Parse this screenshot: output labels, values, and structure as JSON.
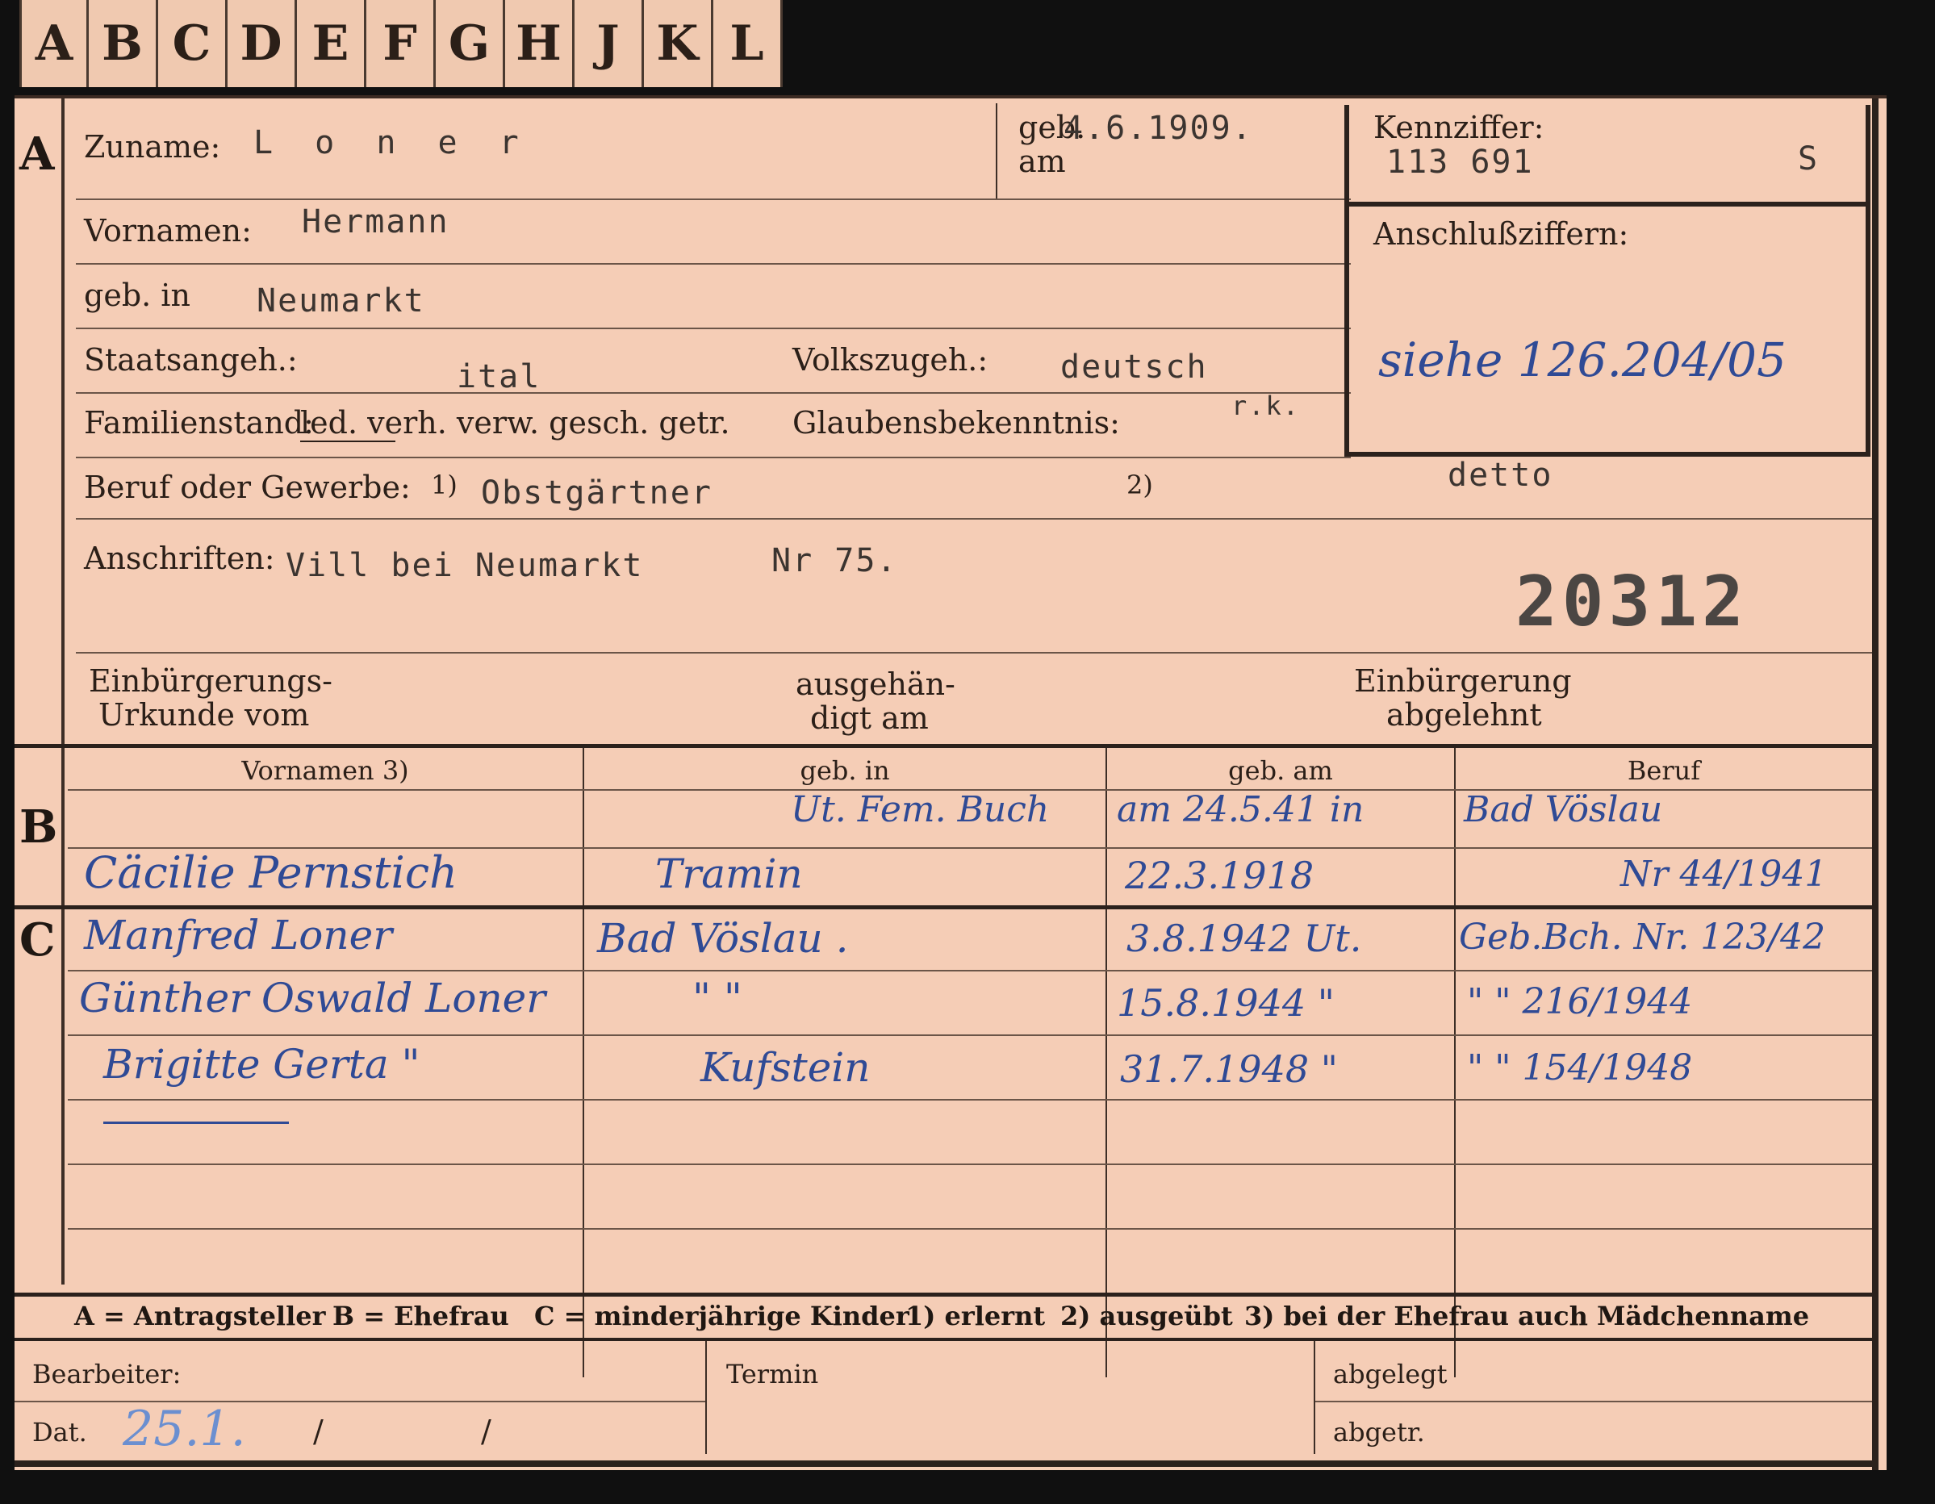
{
  "tabs": [
    "A",
    "B",
    "C",
    "D",
    "E",
    "F",
    "G",
    "H",
    "J",
    "K",
    "L"
  ],
  "section_letters": {
    "a": "A",
    "b": "B",
    "c": "C"
  },
  "applicant": {
    "surname_label": "Zuname:",
    "surname": "L o n e r",
    "birthdate_label_top": "geb.",
    "birthdate_label_bottom": "am",
    "birthdate": "4.6.1909.",
    "given_names_label": "Vornamen:",
    "given_names": "Hermann",
    "birthplace_label": "geb. in",
    "birthplace": "Neumarkt",
    "citizenship_label": "Staatsangeh.:",
    "citizenship": "ital",
    "ethnicity_label": "Volkszugeh.:",
    "ethnicity": "deutsch",
    "marital_label": "Familienstand:",
    "marital_options": "led. verh. verw. gesch. getr.",
    "religion_label": "Glaubensbekenntnis:",
    "religion": "r.k.",
    "occupation_label": "Beruf oder Gewerbe:",
    "occupation_note1": "1)",
    "occupation": "Obstgärtner",
    "occupation_note2": "2)",
    "occupation_practiced": "detto",
    "address_label": "Anschriften:",
    "address": "Vill bei Neumarkt",
    "address_no": "Nr 75.",
    "stamp_number": "20312"
  },
  "id_box": {
    "code_label": "Kennziffer:",
    "code": "113 691",
    "code_suffix": "S",
    "related_label": "Anschlußziffern:",
    "related_note": "siehe 126.204/05"
  },
  "naturalization": {
    "cert_label_1": "Einbürgerungs-",
    "cert_label_2": "Urkunde vom",
    "handed_label_1": "ausgehän-",
    "handed_label_2": "digt am",
    "refused_label_1": "Einbürgerung",
    "refused_label_2": "abgelehnt"
  },
  "family_table": {
    "headers": [
      "Vornamen 3)",
      "geb. in",
      "geb. am",
      "Beruf"
    ],
    "spouse": {
      "line1_place": "Ut. Fem. Buch",
      "line1_date": "am 24.5.41 in",
      "line1_job": "Bad Vöslau",
      "name": "Cäcilie Pernstich",
      "place": "Tramin",
      "date": "22.3.1918",
      "job": "Nr 44/1941"
    },
    "children": [
      {
        "name": "Manfred Loner",
        "place": "Bad Vöslau .",
        "date": "3.8.1942 Ut.",
        "job": "Geb.Bch. Nr. 123/42"
      },
      {
        "name": "Günther Oswald Loner",
        "place": "\"    \"",
        "date": "15.8.1944 \"",
        "job": "\"  \"  216/1944"
      },
      {
        "name": "Brigitte Gerta \"",
        "place": "Kufstein",
        "date": "31.7.1948 \"",
        "job": "\"  \"  154/1948"
      }
    ]
  },
  "legend": {
    "a": "A = Antragsteller",
    "b": "B = Ehefrau",
    "c": "C = minderjährige Kinder",
    "n1": "1) erlernt",
    "n2": "2) ausgeübt",
    "n3": "3) bei der Ehefrau auch Mädchenname"
  },
  "footer": {
    "clerk_label": "Bearbeiter:",
    "date_label": "Dat.",
    "date_value": "25.1.",
    "slash1": "/",
    "slash2": "/",
    "deadline_label": "Termin",
    "filed_label": "abgelegt",
    "filed2_label": "abgetr."
  },
  "colors": {
    "card": "#f5cdb6",
    "ink": "#2f4a95",
    "rule": "#3d2e26"
  }
}
